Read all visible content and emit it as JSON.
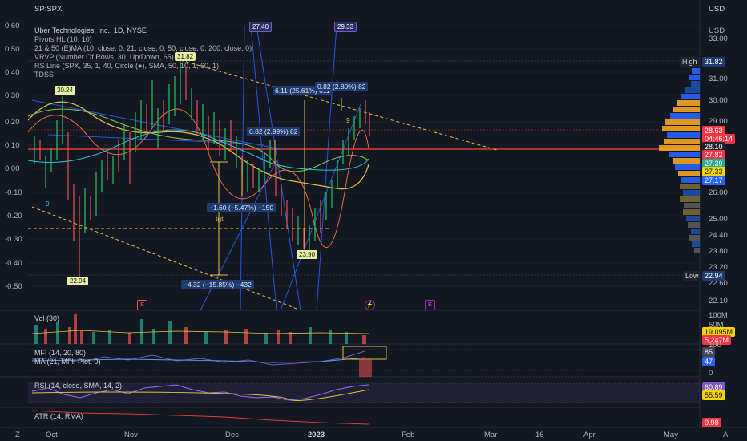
{
  "symbol_header": "SP:SPX",
  "currency_header": "USD",
  "legend": [
    "Uber Technologies, Inc., 1D, NYSE",
    "Pivots HL (10, 10)",
    "21 & 50 (E)MA (10, close, 0, 21, close, 0, 50, close, 0, 200, close, 0)",
    "VRVP (Number Of Rows, 30, Up/Down, 65)",
    "RS Line (SPX, 35, 1, 40, Circle (●), SMA, 50, 10, 1, 60, 1)",
    "TDSS"
  ],
  "left_axis": [
    "0.60",
    "0.50",
    "0.40",
    "0.30",
    "0.20",
    "0.10",
    "0.00",
    "-0.10",
    "-0.20",
    "-0.30",
    "-0.40",
    "-0.50"
  ],
  "right_axis": {
    "currency": "USD",
    "ticks": [
      "33.00",
      "31.00",
      "30.00",
      "29.00",
      "26.00",
      "25.00",
      "24.40",
      "23.80",
      "23.20",
      "22.60",
      "22.10"
    ],
    "high_label": "High",
    "high_value": "31.82",
    "low_label": "Low",
    "low_value": "22.94",
    "price_tags": [
      {
        "value": "28.63",
        "color": "#f23645"
      },
      {
        "value": "04:46:14",
        "color": "#f23645"
      },
      {
        "value": "28.10",
        "color": "#1e222d"
      },
      {
        "value": "27.82",
        "color": "#f23645"
      },
      {
        "value": "27.39",
        "color": "#22ab94"
      },
      {
        "value": "27.33",
        "color": "#f5d300"
      },
      {
        "value": "27.17",
        "color": "#2962ff"
      }
    ]
  },
  "top_tags": [
    "27.40",
    "29.33"
  ],
  "pivots": [
    "30.24",
    "31.82",
    "22.94",
    "23.90"
  ],
  "annotations": {
    "box1": "6.11 (25.61%) 611",
    "box2": "0.82 (2.80%) 82",
    "box3": "0.82 (2.99%) 82",
    "box4": "−1.60 (−5.47%) −150",
    "box5": "−4.32 (−15.85%) −432",
    "tgt": "tgt",
    "marker9a": "9",
    "marker9b": "9"
  },
  "events": [
    {
      "label": "E"
    },
    {
      "label": "⚡"
    },
    {
      "label": "E"
    }
  ],
  "volume": {
    "title": "Vol (30)",
    "ticks": [
      "100M",
      "50M",
      "0"
    ],
    "tag1": "19.095M",
    "tag2": "5.247M"
  },
  "mfi": {
    "title": "MFI (14, 20, 80)",
    "subtitle": "MA (21, MFI, Plot, 0)",
    "ticks": [
      "100",
      "0"
    ],
    "tag1": "85",
    "tag2": "47"
  },
  "rsi": {
    "title": "RSI (14, close, SMA, 14, 2)",
    "tag1": "60.89",
    "tag2": "55.59"
  },
  "atr": {
    "title": "ATR (14, RMA)",
    "tag": "0.98"
  },
  "time_axis": [
    "Oct",
    "Nov",
    "Dec",
    "2023",
    "Feb",
    "Mar",
    "16",
    "Apr",
    "May"
  ],
  "bottom_left": "Z",
  "bottom_right": "A",
  "colors": {
    "bg": "#131722",
    "up": "#22c55e",
    "down": "#ef5350",
    "accent": "#2962ff",
    "ema_yellow": "#e6c13c",
    "trend_red": "#e53935"
  }
}
